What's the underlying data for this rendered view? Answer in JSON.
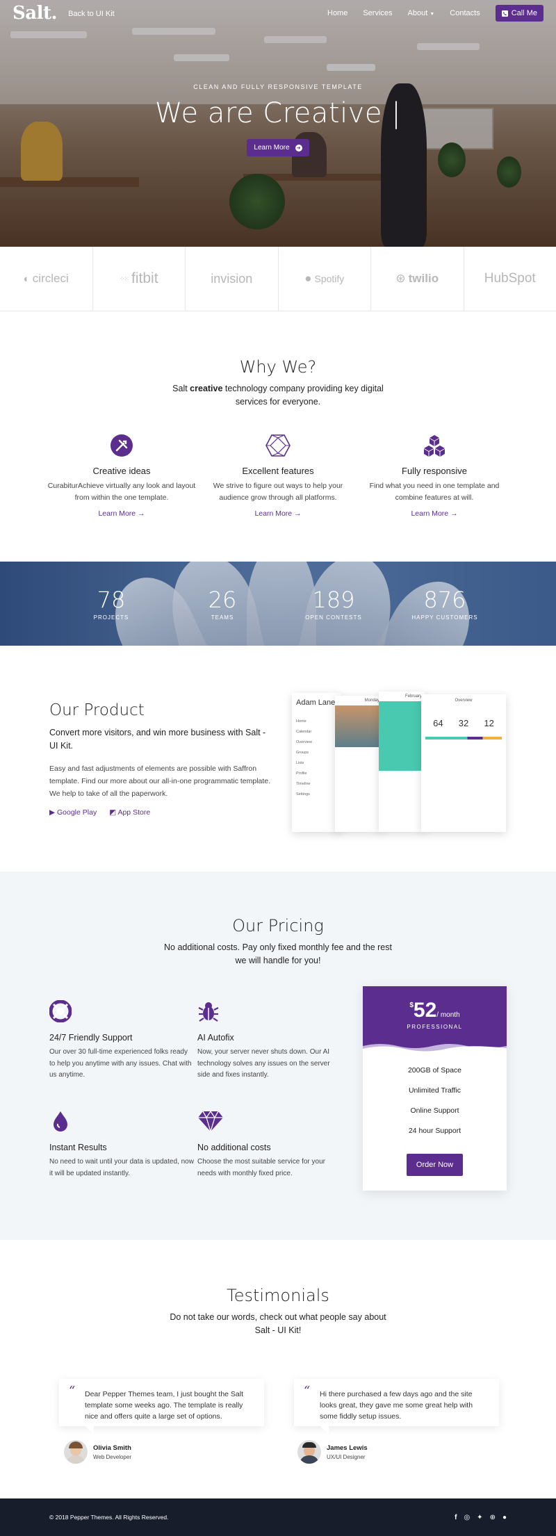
{
  "nav": {
    "logo": "Salt.",
    "back_link": "Back to UI Kit",
    "items": [
      "Home",
      "Services",
      "About",
      "Contacts"
    ],
    "call_me": "Call Me"
  },
  "hero": {
    "eyebrow": "CLEAN AND FULLY RESPONSIVE TEMPLATE",
    "title": "We are Creative |",
    "button": "Learn More"
  },
  "partners": [
    "circleci",
    "fitbit",
    "invision",
    "Spotify",
    "twilio",
    "HubSpot"
  ],
  "why": {
    "title": "Why We?",
    "subtitle_pre": "Salt ",
    "subtitle_bold": "creative",
    "subtitle_post": " technology company providing key digital services for everyone.",
    "features": [
      {
        "title": "Creative ideas",
        "text": "CurabiturAchieve virtually any look and layout from within the one template.",
        "link": "Learn More",
        "icon": "tools-icon"
      },
      {
        "title": "Excellent features",
        "text": "We strive to figure out ways to help your audience grow through all platforms.",
        "link": "Learn More",
        "icon": "hexagon-icon"
      },
      {
        "title": "Fully responsive",
        "text": "Find what you need in one template and combine features at will.",
        "link": "Learn More",
        "icon": "cubes-icon"
      }
    ]
  },
  "stats": [
    {
      "num": "78",
      "label": "PROJECTS"
    },
    {
      "num": "26",
      "label": "TEAMS"
    },
    {
      "num": "189",
      "label": "OPEN CONTESTS"
    },
    {
      "num": "876",
      "label": "HAPPY CUSTOMERS"
    }
  ],
  "product": {
    "title": "Our Product",
    "lead": "Convert more visitors, and win more business with Salt - UI Kit.",
    "body": "Easy and fast adjustments of elements are possible with Saffron template. Find our more about our all-in-one programmatic template. We help to take of all the paperwork.",
    "google_play": "Google Play",
    "app_store": "App Store",
    "mock": {
      "name": "Adam Lane",
      "menu": [
        "Home",
        "Calendar",
        "Overview",
        "Groups",
        "Lists",
        "Profile",
        "Timeline",
        "Settings"
      ],
      "tabs": [
        "Monday",
        "February",
        "Overview"
      ],
      "stats": [
        "64",
        "32",
        "12"
      ]
    }
  },
  "pricing": {
    "title": "Our Pricing",
    "subtitle": "No additional costs. Pay only fixed monthly fee and the rest we will handle for you!",
    "features": [
      {
        "title": "24/7 Friendly Support",
        "text": "Our over 30 full-time experienced folks ready to help you anytime with any issues. Chat with us anytime.",
        "icon": "lifebuoy-icon"
      },
      {
        "title": "AI Autofix",
        "text": "Now, your server never shuts down. Our AI technology solves any issues on the server side and fixes instantly.",
        "icon": "bug-icon"
      },
      {
        "title": "Instant Results",
        "text": "No need to wait until your data is updated, now it will be updated instantly.",
        "icon": "drop-icon"
      },
      {
        "title": "No additional costs",
        "text": "Choose the most suitable service for your needs with monthly fixed price.",
        "icon": "diamond-icon"
      }
    ],
    "plan": {
      "currency": "$",
      "amount": "52",
      "period": "/ month",
      "tier": "PROFESSIONAL",
      "items": [
        "200GB of Space",
        "Unlimited Traffic",
        "Online Support",
        "24 hour Support"
      ],
      "button": "Order Now"
    }
  },
  "testimonials": {
    "title": "Testimonials",
    "subtitle": "Do not take our words, check out what people say about Salt - UI Kit!",
    "items": [
      {
        "text": "Dear Pepper Themes team, I just bought the Salt template some weeks ago. The template is really nice and offers quite a large set of options.",
        "name": "Olivia Smith",
        "role": "Web Developer"
      },
      {
        "text": "Hi there purchased a few days ago and the site looks great, they gave me some great help with some fiddly setup issues.",
        "name": "James Lewis",
        "role": "UX/UI Designer"
      }
    ]
  },
  "footer": {
    "copyright": "© 2018 Pepper Themes. All Rights Reserved.",
    "socials": [
      "facebook-icon",
      "instagram-icon",
      "twitter-icon",
      "dribbble-icon",
      "github-icon"
    ]
  },
  "colors": {
    "accent": "#5b2d8e",
    "footer": "#171d2b",
    "pricing_bg": "#f3f6f9"
  }
}
